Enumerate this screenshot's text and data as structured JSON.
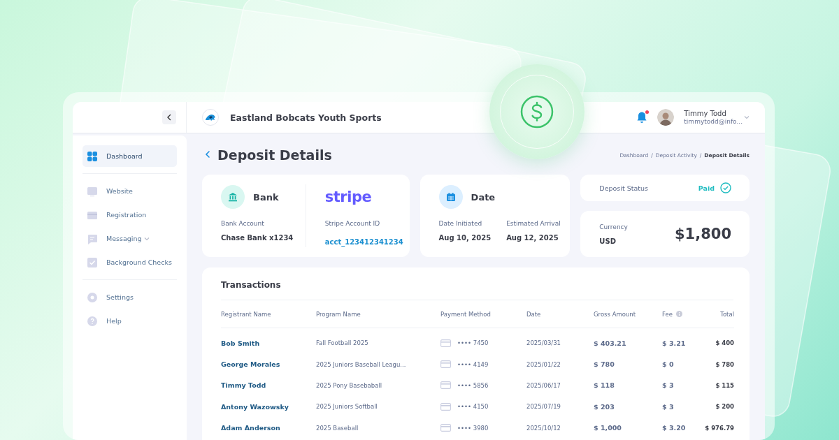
{
  "header": {
    "org_name": "Eastland Bobcats Youth Sports",
    "notifications": {
      "unread": true
    },
    "user": {
      "name": "Timmy Todd",
      "email": "timmytodd@info..."
    }
  },
  "sidebar": {
    "sections": [
      [
        {
          "label": "Dashboard",
          "selected": true,
          "expandable": false
        }
      ],
      [
        {
          "label": "Website",
          "selected": false,
          "expandable": false
        },
        {
          "label": "Registration",
          "selected": false,
          "expandable": false
        },
        {
          "label": "Messaging",
          "selected": false,
          "expandable": true
        },
        {
          "label": "Background Checks",
          "selected": false,
          "expandable": false
        }
      ],
      [
        {
          "label": "Settings",
          "selected": false,
          "expandable": false
        },
        {
          "label": "Help",
          "selected": false,
          "expandable": false
        }
      ]
    ]
  },
  "page": {
    "title": "Deposit Details",
    "breadcrumb": {
      "separator": "/",
      "items": [
        "Dashboard",
        "Deposit Activity",
        "Deposit Details"
      ]
    }
  },
  "bank": {
    "title": "Bank",
    "label": "Bank Account",
    "value": "Chase Bank x1234"
  },
  "stripe": {
    "logo": "stripe",
    "label": "Stripe Account ID",
    "value": "acct_123412341234"
  },
  "dates": {
    "title": "Date",
    "fields": [
      {
        "label": "Date Initiated",
        "value": "Aug 10, 2025"
      },
      {
        "label": "Estimated Arrival",
        "value": "Aug 12, 2025"
      }
    ]
  },
  "status": {
    "label": "Deposit Status",
    "value": "Paid",
    "paid": true
  },
  "currency": {
    "label": "Currency",
    "value": "USD",
    "amount": "$1,800"
  },
  "transactions": {
    "title": "Transactions",
    "columns": [
      {
        "label": "Registrant Name",
        "info": false
      },
      {
        "label": "Program Name",
        "info": false
      },
      {
        "label": "Payment Method",
        "info": false
      },
      {
        "label": "Date",
        "info": false
      },
      {
        "label": "Gross Amount",
        "info": false
      },
      {
        "label": "Fee",
        "info": true
      },
      {
        "label": "Total",
        "info": false
      }
    ],
    "rows": [
      {
        "registrant": "Bob Smith",
        "program": "Fall Football 2025",
        "card": "•••• 7450",
        "date": "2025/03/31",
        "gross": "$ 403.21",
        "fee": "$ 3.21",
        "total": "$ 400"
      },
      {
        "registrant": "George Morales",
        "program": "2025 Juniors Baseball Leagu...",
        "card": "•••• 4149",
        "date": "2025/01/22",
        "gross": "$ 780",
        "fee": "$ 0",
        "total": "$ 780"
      },
      {
        "registrant": "Timmy Todd",
        "program": "2025 Pony Basebaball",
        "card": "•••• 5856",
        "date": "2025/06/17",
        "gross": "$ 118",
        "fee": "$ 3",
        "total": "$ 115"
      },
      {
        "registrant": "Antony Wazowsky",
        "program": "2025 Juniors Softball",
        "card": "•••• 4150",
        "date": "2025/07/19",
        "gross": "$ 203",
        "fee": "$ 3",
        "total": "$ 200"
      },
      {
        "registrant": "Adam Anderson",
        "program": "2025 Baseball",
        "card": "•••• 3980",
        "date": "2025/10/12",
        "gross": "$ 1,000",
        "fee": "$ 3.20",
        "total": "$ 976.79"
      }
    ]
  }
}
